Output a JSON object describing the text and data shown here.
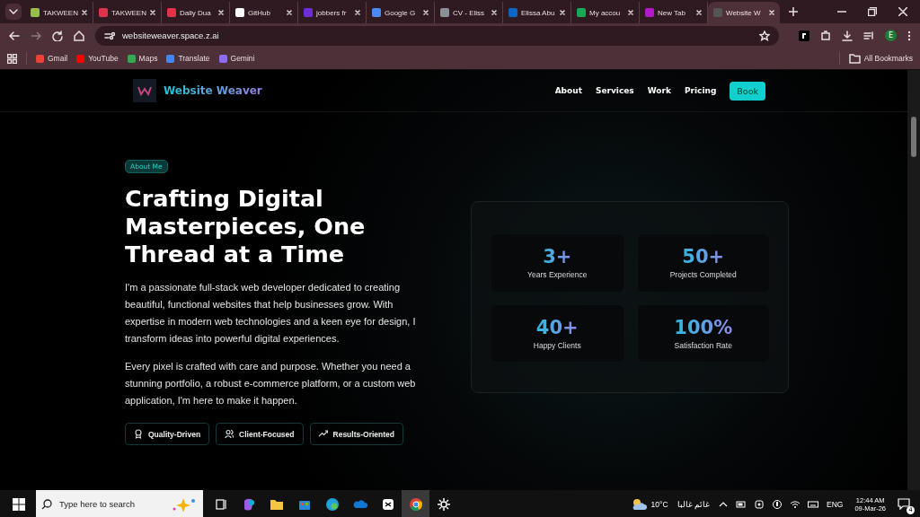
{
  "browser": {
    "tabs": [
      {
        "title": "TAKWEEN",
        "color": "#95bf47",
        "selected": false
      },
      {
        "title": "TAKWEEN",
        "color": "#e0334a",
        "selected": false
      },
      {
        "title": "Daily Dua",
        "color": "#e0334a",
        "selected": false
      },
      {
        "title": "GitHub",
        "color": "#ffffff",
        "selected": false
      },
      {
        "title": "jobbers fr",
        "color": "#6b2fd6",
        "selected": false
      },
      {
        "title": "Google G",
        "color": "#4a8af4",
        "selected": false
      },
      {
        "title": "CV - Eliss",
        "color": "#8a8f98",
        "selected": false
      },
      {
        "title": "Elissa Abu",
        "color": "#0a66c2",
        "selected": false
      },
      {
        "title": "My accou",
        "color": "#18a957",
        "selected": false
      },
      {
        "title": "New Tab",
        "color": "#b318c9",
        "selected": false
      },
      {
        "title": "Website W",
        "color": "#555555",
        "selected": true
      }
    ],
    "address": "websiteweaver.space.z.ai",
    "profile": "E",
    "bookmarks": [
      {
        "label": "Gmail",
        "color": "#ea4335"
      },
      {
        "label": "YouTube",
        "color": "#ff0000"
      },
      {
        "label": "Maps",
        "color": "#34a853"
      },
      {
        "label": "Translate",
        "color": "#4285f4"
      },
      {
        "label": "Gemini",
        "color": "#8e6cf0"
      }
    ],
    "all_bookmarks": "All Bookmarks"
  },
  "site": {
    "brand": "Website Weaver",
    "nav": [
      "About",
      "Services",
      "Work",
      "Pricing"
    ],
    "cta": "Book",
    "badge": "About Me",
    "heading": "Crafting Digital Masterpieces, One Thread at a Time",
    "paragraphs": [
      "I'm a passionate full-stack web developer dedicated to creating beautiful, functional websites that help businesses grow. With expertise in modern web technologies and a keen eye for design, I transform ideas into powerful digital experiences.",
      "Every pixel is crafted with care and purpose. Whether you need a stunning portfolio, a robust e-commerce platform, or a custom web application, I'm here to make it happen."
    ],
    "traits": [
      {
        "label": "Quality-Driven",
        "kind": "award"
      },
      {
        "label": "Client-Focused",
        "kind": "users"
      },
      {
        "label": "Results-Oriented",
        "kind": "trend"
      }
    ],
    "stats": [
      {
        "value": "3+",
        "label": "Years Experience"
      },
      {
        "value": "50+",
        "label": "Projects Completed"
      },
      {
        "value": "40+",
        "label": "Happy Clients"
      },
      {
        "value": "100%",
        "label": "Satisfaction Rate"
      }
    ]
  },
  "taskbar": {
    "search_placeholder": "Type here to search",
    "weather": "10°C",
    "weather_text": "غائم غالبا",
    "language": "ENG",
    "time": "12:44 AM",
    "date": "09-Mar-26",
    "notifications": "4"
  }
}
